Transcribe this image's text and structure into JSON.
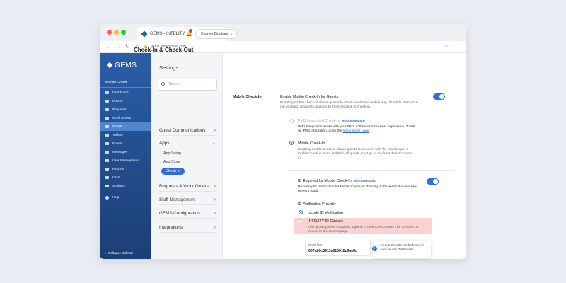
{
  "browser": {
    "tab_title": "GEMS - INTELITY",
    "url": "gems.intelitypeed.com"
  },
  "sidebar": {
    "logo": "GEMS",
    "property": "Macau Grand",
    "items": [
      {
        "label": "Dashboard",
        "icon": "dashboard-icon"
      },
      {
        "label": "Rooms",
        "icon": "bed-icon"
      },
      {
        "label": "Requests",
        "icon": "bell-icon"
      },
      {
        "label": "Work Orders",
        "icon": "clipboard-icon"
      },
      {
        "label": "Guests",
        "icon": "users-icon",
        "active": true
      },
      {
        "label": "Tablets",
        "icon": "tablet-icon"
      },
      {
        "label": "Events",
        "icon": "calendar-icon"
      },
      {
        "label": "Messages",
        "icon": "mail-icon"
      },
      {
        "label": "User Management",
        "icon": "user-gear-icon"
      },
      {
        "label": "Reports",
        "icon": "chart-icon"
      },
      {
        "label": "CMS",
        "icon": "edit-icon"
      },
      {
        "label": "Settings",
        "icon": "gear-icon"
      }
    ],
    "help": "Help",
    "collapse": "Collapse Sidebar",
    "accent": "#2a5ea8"
  },
  "settings_nav": {
    "title": "Settings",
    "search_placeholder": "Search",
    "sections": {
      "guest_comms": "Guest Communications",
      "apps": "Apps",
      "app_setup": "App Setup",
      "app_store": "App Store",
      "check_in": "Check-In",
      "requests": "Requests & Work Orders",
      "staff": "Staff Management",
      "gems_config": "GEMS Configuration",
      "integrations": "Integrations"
    }
  },
  "header": {
    "user": "Charles Bingham"
  },
  "content": {
    "title": "Check-In & Check-Out",
    "section_label": "Mobile Check-In",
    "enable_title": "Enable Mobile Check-In for Guests",
    "enable_desc": "Enabling mobile check-in allows guests to check-in with the mobile app. If mobile check-in is not enabled, all guests must go to the front desk to check-in.",
    "pms_title": "PMS Integrated Check-In",
    "recommended": "RECOMMENDED",
    "pms_desc_prefix": "PMS Integration works with your PMS software for the best experience. To set up PMS integration, go to the",
    "pms_link": "Integrations page",
    "mobile_title": "Mobile Check-In",
    "mobile_desc": "Enabling mobile check-in allows guests to check-in with the mobile app. If mobile check-in is not enabled, all guests must go to the front desk to check-in.",
    "id_title": "ID Required for Mobile Check-In",
    "id_desc": "Requiring ID Verification for Mobile Check-In. Turning on ID Verification will help prevent fraud.",
    "provider_label": "ID Verification Provider",
    "incode_label": "Incode ID Verification",
    "intelity_title": "INTELITY ID Capture",
    "intelity_desc": "This allows guests to upload a photo of their ID to GEMS. The ID's can be viewed in the Guests page.",
    "flow_label": "Incode Flow",
    "flow_value": "607a26c5911e510018c9ae8d",
    "tooltip": "Incode Flow ID can be found in your Incode Dashboard.",
    "toggle_color": "#2f6fd6",
    "highlight_color": "#fbd3d3"
  }
}
